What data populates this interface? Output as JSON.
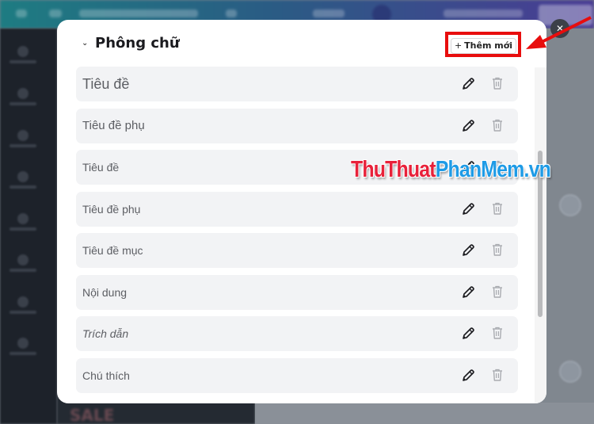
{
  "modal": {
    "title": "Phông chữ",
    "add_button_label": "Thêm mới",
    "add_button_icon": "plus-icon",
    "collapse_icon": "chevron-down-icon",
    "close_icon": "close-icon"
  },
  "font_styles": [
    {
      "label": "Tiêu đề",
      "size": "large",
      "italic": false
    },
    {
      "label": "Tiêu đề phụ",
      "size": "medium",
      "italic": false
    },
    {
      "label": "Tiêu đề",
      "size": "small",
      "italic": false
    },
    {
      "label": "Tiêu đề phụ",
      "size": "small",
      "italic": false
    },
    {
      "label": "Tiêu đề mục",
      "size": "small",
      "italic": false
    },
    {
      "label": "Nội dung",
      "size": "small",
      "italic": false
    },
    {
      "label": "Trích dẫn",
      "size": "small",
      "italic": true
    },
    {
      "label": "Chú thích",
      "size": "small",
      "italic": false
    }
  ],
  "row_actions": {
    "edit_icon": "pencil-icon",
    "delete_icon": "trash-icon"
  },
  "watermark": {
    "part1": "ThuThuat",
    "part2": "PhanMem",
    "part3": ".vn",
    "color1": "#e8213a",
    "color2": "#1e9be6"
  },
  "annotation": {
    "highlight_color": "#e80d0d"
  },
  "background": {
    "sale_text": "SALE"
  }
}
